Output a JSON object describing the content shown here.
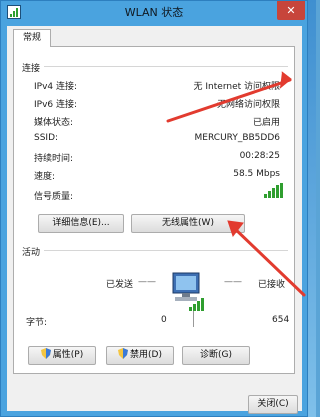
{
  "window": {
    "title": "WLAN 状态",
    "close_glyph": "✕"
  },
  "tabs": [
    {
      "label": "常规"
    }
  ],
  "connection": {
    "group_label": "连接",
    "rows": [
      {
        "label": "IPv4 连接:",
        "value": "无 Internet 访问权限"
      },
      {
        "label": "IPv6 连接:",
        "value": "无网络访问权限"
      },
      {
        "label": "媒体状态:",
        "value": "已启用"
      },
      {
        "label": "SSID:",
        "value": "MERCURY_BB5DD6"
      },
      {
        "label": "持续时间:",
        "value": "00:28:25"
      },
      {
        "label": "速度:",
        "value": "58.5 Mbps"
      }
    ],
    "signal_label": "信号质量:",
    "signal_bars": 5,
    "details_button": "详细信息(E)...",
    "wireless_props_button": "无线属性(W)"
  },
  "activity": {
    "group_label": "活动",
    "sent_label": "已发送",
    "received_label": "已接收",
    "dash": "——",
    "bytes_label": "字节:",
    "bytes_sent": "0",
    "bytes_received": "654"
  },
  "actions": {
    "properties_button": "属性(P)",
    "disable_button": "禁用(D)",
    "diagnose_button": "诊断(G)"
  },
  "footer": {
    "close_button": "关闭(C)"
  },
  "colors": {
    "titlebar": "#4aa3df",
    "close": "#c7453b",
    "signal": "#2f9e2f",
    "annotation_arrow": "#e23b2f"
  },
  "icons": {
    "title": "wifi-status-icon",
    "signal": "signal-strength-icon",
    "activity": "network-computer-icon",
    "shield": "uac-shield-icon"
  }
}
